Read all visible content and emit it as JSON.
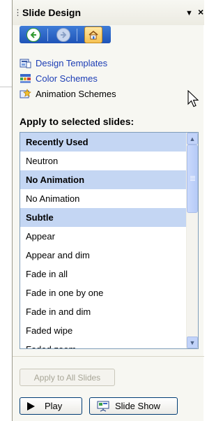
{
  "pane": {
    "title": "Slide Design",
    "menu_arrow": "▼",
    "close": "×"
  },
  "nav": {
    "back_icon": "back-arrow",
    "forward_icon": "forward-arrow",
    "home_icon": "home"
  },
  "links": [
    {
      "label": "Design Templates",
      "icon": "design-templates-icon"
    },
    {
      "label": "Color Schemes",
      "icon": "color-schemes-icon"
    },
    {
      "label": "Animation Schemes",
      "icon": "animation-schemes-icon"
    }
  ],
  "apply_heading": "Apply to selected slides:",
  "list": {
    "rows": [
      {
        "label": "Recently Used",
        "header": true
      },
      {
        "label": "Neutron",
        "header": false
      },
      {
        "label": "No Animation",
        "header": true
      },
      {
        "label": "No Animation",
        "header": false
      },
      {
        "label": "Subtle",
        "header": true
      },
      {
        "label": "Appear",
        "header": false
      },
      {
        "label": "Appear and dim",
        "header": false
      },
      {
        "label": "Fade in all",
        "header": false
      },
      {
        "label": "Fade in one by one",
        "header": false
      },
      {
        "label": "Fade in and dim",
        "header": false
      },
      {
        "label": "Faded wipe",
        "header": false
      },
      {
        "label": "Faded zoom",
        "header": false
      }
    ]
  },
  "buttons": {
    "apply_all": "Apply to All Slides",
    "play": "Play",
    "slide_show": "Slide Show"
  },
  "colors": {
    "link": "#1c3db5",
    "list_header": "#c4d6f3",
    "nav_bar": "#2b63c6"
  }
}
